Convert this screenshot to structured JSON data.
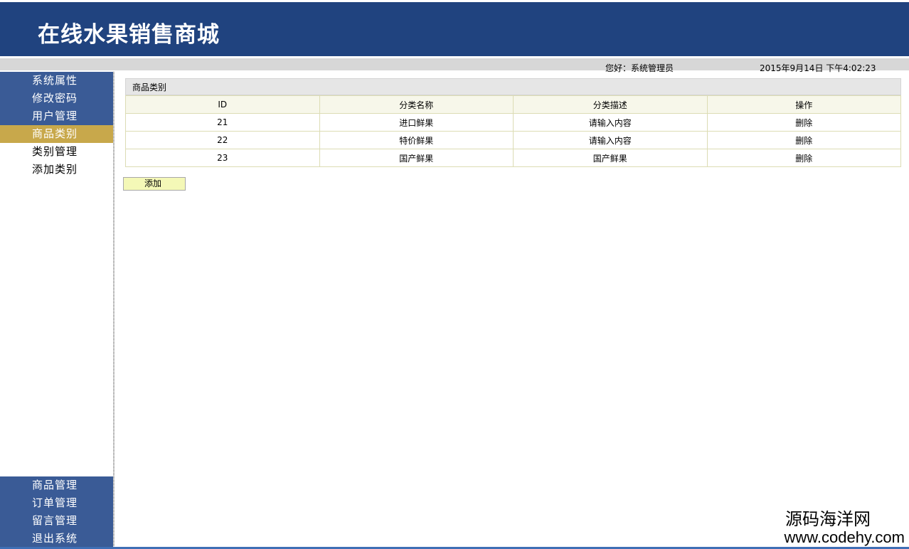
{
  "header": {
    "title": "在线水果销售商城"
  },
  "infobar": {
    "greeting": "您好：系统管理员",
    "datetime": "2015年9月14日  下午4:02:23"
  },
  "sidebar": {
    "top_items": [
      {
        "label": "系统属性"
      },
      {
        "label": "修改密码"
      },
      {
        "label": "用户管理"
      },
      {
        "label": "商品类别"
      }
    ],
    "sub_items": [
      {
        "label": "类别管理"
      },
      {
        "label": "添加类别"
      }
    ],
    "bottom_items": [
      {
        "label": "商品管理"
      },
      {
        "label": "订单管理"
      },
      {
        "label": "留言管理"
      },
      {
        "label": "退出系统"
      }
    ]
  },
  "panel": {
    "title": "商品类别",
    "columns": [
      "ID",
      "分类名称",
      "分类描述",
      "操作"
    ],
    "rows": [
      {
        "id": "21",
        "name": "进口鲜果",
        "desc": "请输入内容",
        "action": "删除"
      },
      {
        "id": "22",
        "name": "特价鲜果",
        "desc": "请输入内容",
        "action": "删除"
      },
      {
        "id": "23",
        "name": "国产鲜果",
        "desc": "国产鲜果",
        "action": "删除"
      }
    ],
    "add_label": "添加"
  },
  "watermark": {
    "cn": "源码海洋网",
    "url": "www.codehy.com"
  },
  "colors": {
    "header_bg": "#20437f",
    "menu_blue": "#3a5b96",
    "menu_active": "#c8a84b",
    "add_button": "#f4f8b7"
  }
}
